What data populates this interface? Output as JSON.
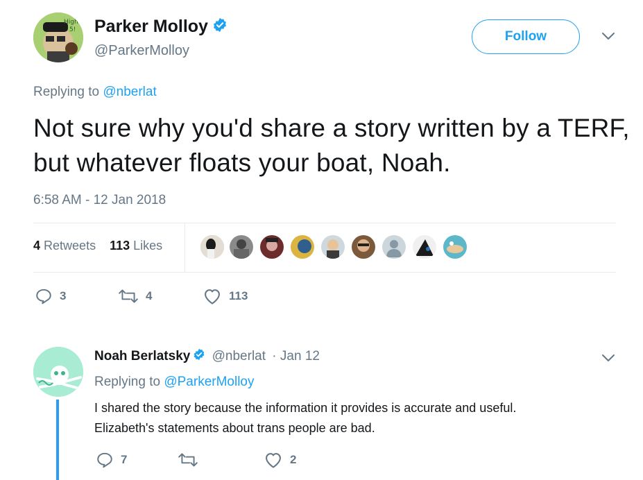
{
  "main_tweet": {
    "author_name": "Parker Molloy",
    "author_handle": "@ParkerMolloy",
    "follow_label": "Follow",
    "replying_prefix": "Replying to",
    "replying_to": "@nberlat",
    "text": "Not sure why you'd share a story written by a TERF, but whatever floats your boat, Noah.",
    "timestamp": "6:58 AM - 12 Jan 2018",
    "retweets_count": "4",
    "retweets_label": "Retweets",
    "likes_count": "113",
    "likes_label": "Likes",
    "actions": {
      "replies": "3",
      "retweets": "4",
      "likes": "113"
    }
  },
  "reply_tweet": {
    "author_name": "Noah Berlatsky",
    "author_handle": "@nberlat",
    "date": "· Jan 12",
    "replying_prefix": "Replying to",
    "replying_to": "@ParkerMolloy",
    "text_line1": "I shared the story because the information it provides is accurate and useful.",
    "text_line2": "Elizabeth's statements about trans people are bad.",
    "actions": {
      "replies": "7",
      "retweets": "",
      "likes": "2"
    }
  },
  "colors": {
    "accent": "#1da1f2",
    "muted": "#657786",
    "text": "#14171a",
    "divider": "#e6ecf0",
    "thread_line": "#2b9cf3"
  },
  "icons": [
    "verified-badge-icon",
    "chevron-down-icon",
    "reply-icon",
    "retweet-icon",
    "heart-icon"
  ]
}
